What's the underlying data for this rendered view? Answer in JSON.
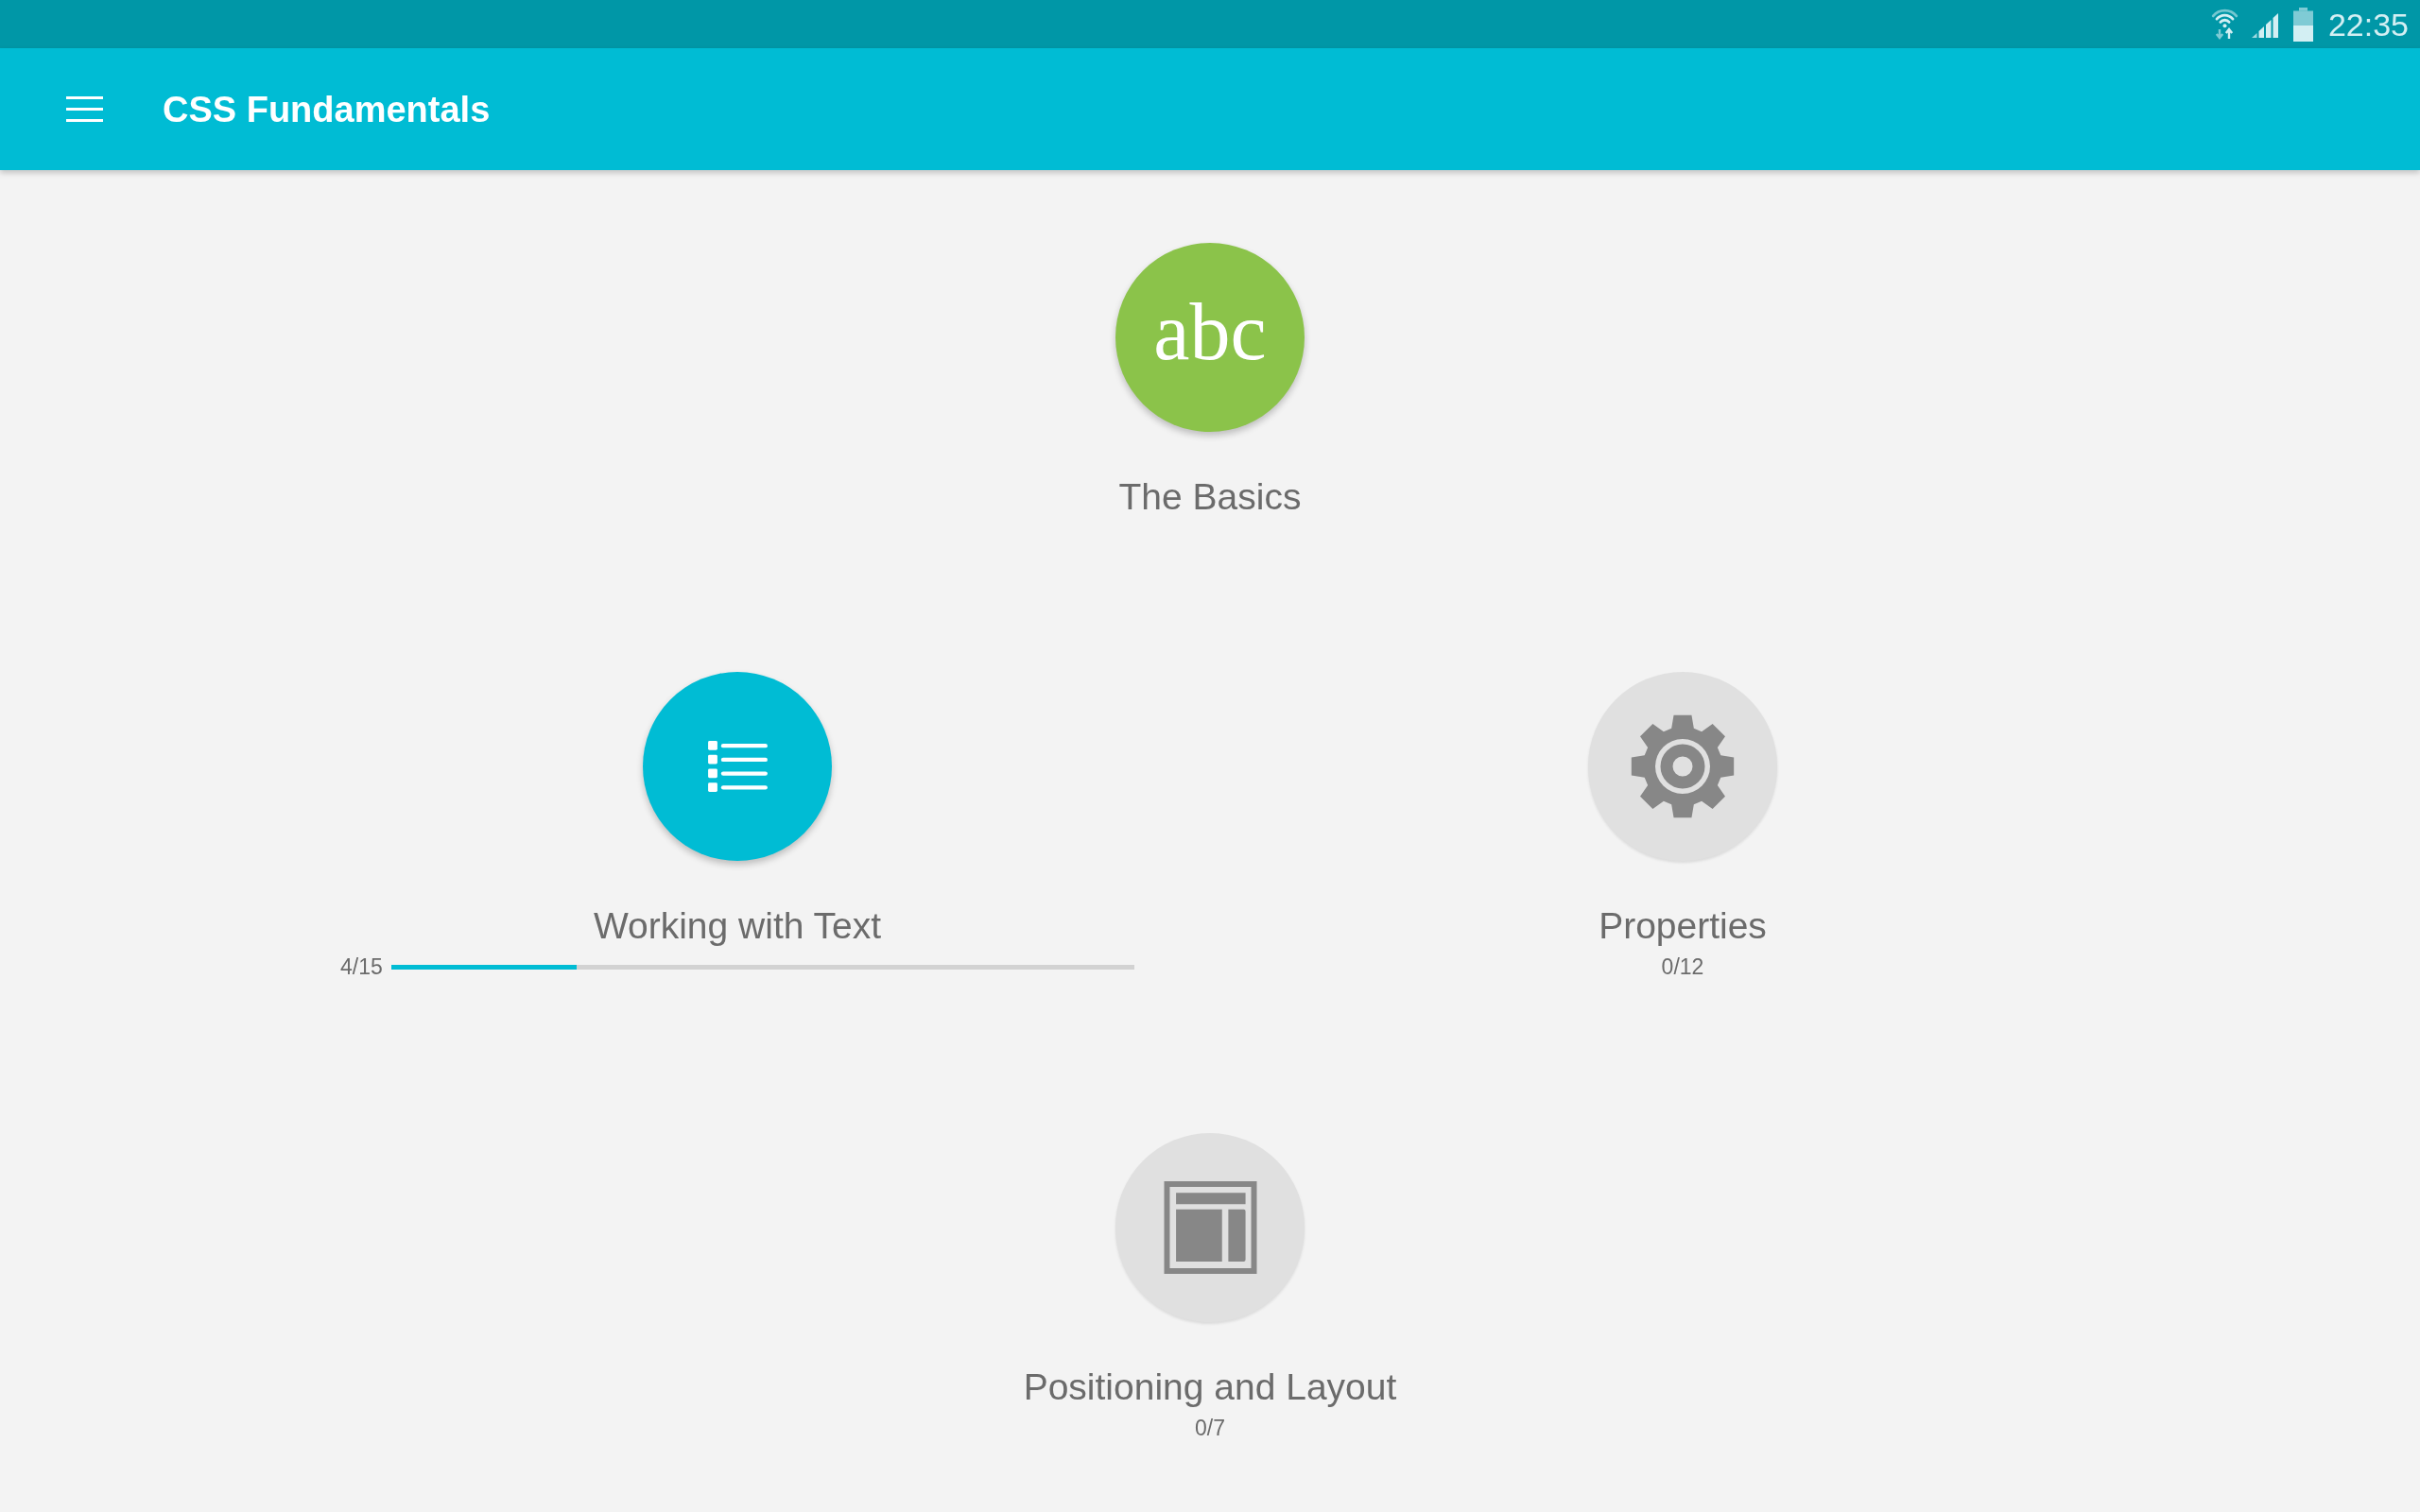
{
  "status_bar": {
    "time": "22:35"
  },
  "app_bar": {
    "title": "CSS Fundamentals"
  },
  "lesson_rows": [
    [
      {
        "title": "The Basics",
        "color": "#8bc34a",
        "locked": false,
        "icon_text": "abc"
      }
    ],
    [
      {
        "title": "Working with Text",
        "color": "#00bcd4",
        "locked": false,
        "progress": "4/15",
        "level": 0.25
      },
      {
        "title": "Properties",
        "color": "#e0e0e0",
        "locked": true,
        "progress": "0/12"
      }
    ],
    [
      {
        "title": "Positioning and Layout",
        "color": "#e0e0e0",
        "locked": true,
        "progress": "0/7"
      }
    ]
  ]
}
